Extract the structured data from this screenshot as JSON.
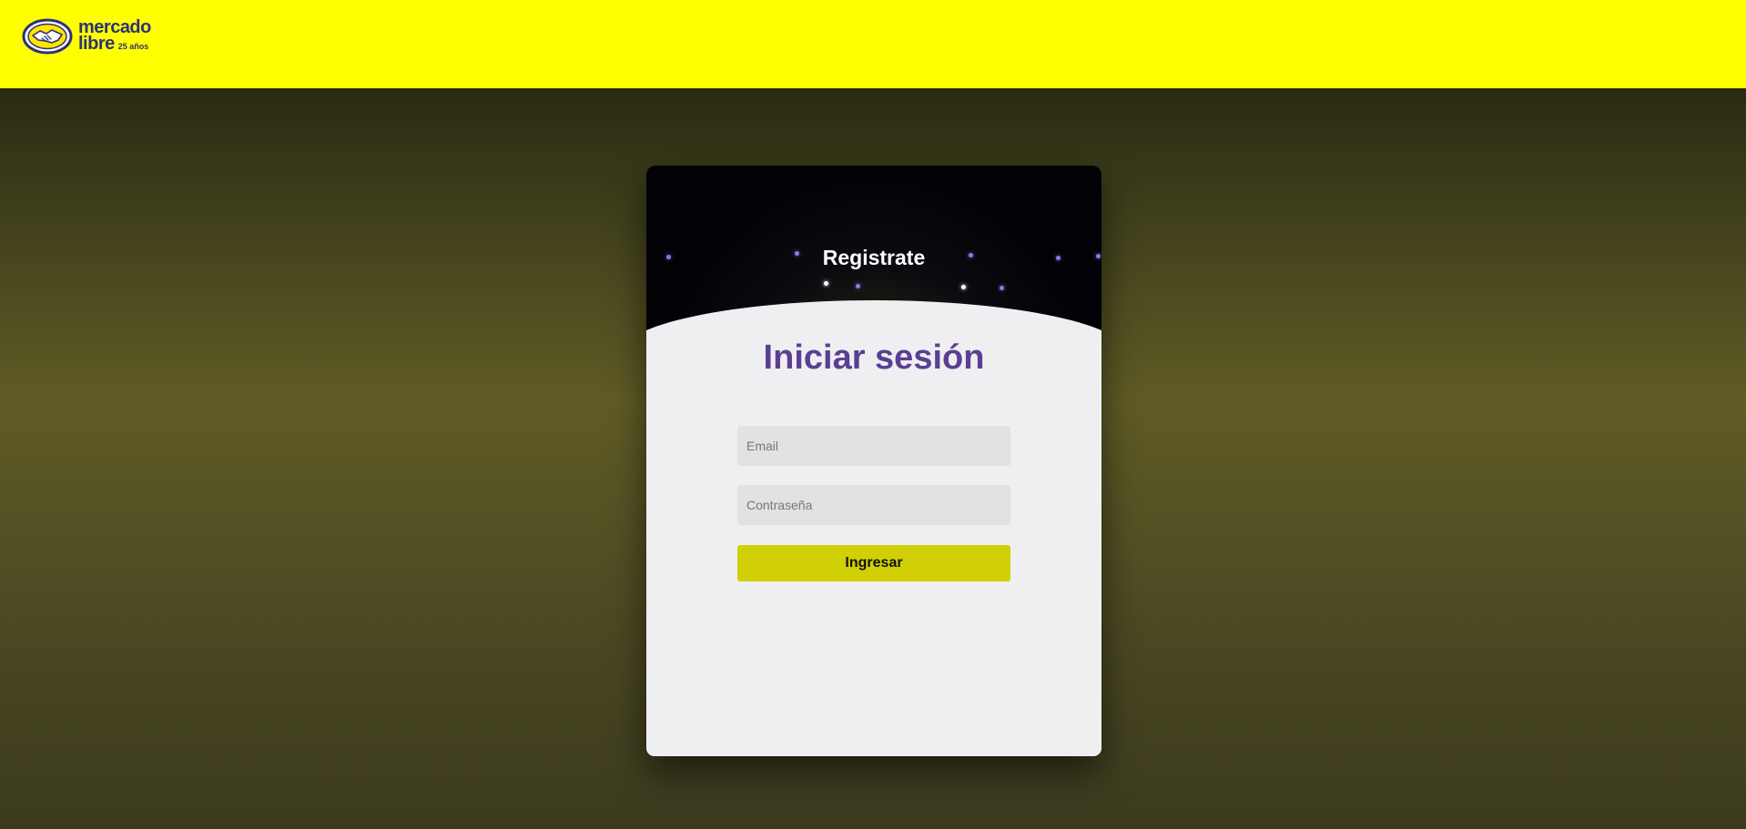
{
  "header": {
    "brand_line1": "mercado",
    "brand_line2": "libre",
    "brand_sub": "25 años",
    "brand_color": "#2d3277",
    "bar_color": "#ffff00"
  },
  "card": {
    "register_label": "Registrate",
    "title": "Iniciar sesión",
    "title_color": "#5b3f93",
    "email_placeholder": "Email",
    "password_placeholder": "Contraseña",
    "submit_label": "Ingresar",
    "submit_color": "#d1cf05"
  }
}
